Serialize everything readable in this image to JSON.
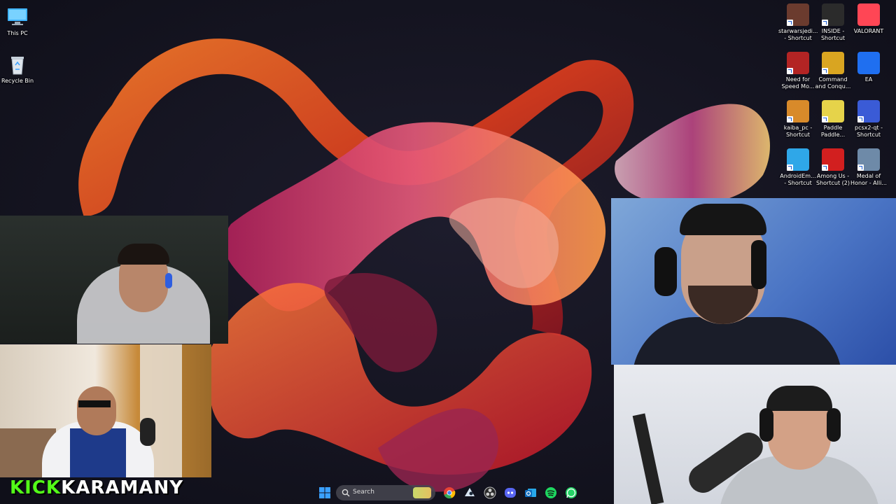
{
  "desktop": {
    "left_icons": [
      {
        "label": "This PC",
        "icon": "monitor-icon"
      },
      {
        "label": "Recycle Bin",
        "icon": "recycle-bin-icon"
      }
    ],
    "right_icons": [
      {
        "line1": "starwarsjedi...",
        "line2": "- Shortcut",
        "icon": "star-wars-jedi-icon",
        "color": "#6b3b2e"
      },
      {
        "line1": "INSIDE -",
        "line2": "Shortcut",
        "icon": "inside-icon",
        "color": "#2b2b2b"
      },
      {
        "line1": "VALORANT",
        "line2": "",
        "icon": "valorant-icon",
        "color": "#ff4655"
      },
      {
        "line1": "Need for",
        "line2": "Speed Mo...",
        "icon": "need-for-speed-icon",
        "color": "#b32424"
      },
      {
        "line1": "Command",
        "line2": "and Conqu...",
        "icon": "command-and-conquer-icon",
        "color": "#d9a521"
      },
      {
        "line1": "EA",
        "line2": "",
        "icon": "ea-icon",
        "color": "#1f6ff0"
      },
      {
        "line1": "kaiba_pc -",
        "line2": "Shortcut",
        "icon": "kaiba-icon",
        "color": "#d88a2a"
      },
      {
        "line1": "Paddle",
        "line2": "Paddle...",
        "icon": "paddle-icon",
        "color": "#e6d34a"
      },
      {
        "line1": "pcsx2-qt -",
        "line2": "Shortcut",
        "icon": "pcsx2-icon",
        "color": "#3a5bd6"
      },
      {
        "line1": "AndroidEm...",
        "line2": "- Shortcut",
        "icon": "android-emulator-icon",
        "color": "#2fa7e8"
      },
      {
        "line1": "Among Us -",
        "line2": "Shortcut (2)",
        "icon": "among-us-icon",
        "color": "#d21f1f"
      },
      {
        "line1": "Medal of",
        "line2": "Honor - Alli...",
        "icon": "medal-of-honor-icon",
        "color": "#6e8aa8"
      }
    ]
  },
  "taskbar": {
    "search_placeholder": "Search",
    "apps": [
      {
        "name": "start-button",
        "icon": "windows-icon",
        "color": "#3aa0ff"
      },
      {
        "name": "widgets-button",
        "icon": "widgets-icon",
        "color": "#c8d86a"
      },
      {
        "name": "chrome-button",
        "icon": "chrome-icon",
        "color": "#e84335"
      },
      {
        "name": "steam-button",
        "icon": "steam-icon",
        "color": "#1b2838"
      },
      {
        "name": "obs-button",
        "icon": "obs-icon",
        "color": "#444444"
      },
      {
        "name": "discord-button",
        "icon": "discord-icon",
        "color": "#5865f2"
      },
      {
        "name": "outlook-button",
        "icon": "outlook-icon",
        "color": "#1f6fd6"
      },
      {
        "name": "spotify-button",
        "icon": "spotify-icon",
        "color": "#1ed760"
      },
      {
        "name": "whatsapp-button",
        "icon": "whatsapp-icon",
        "color": "#25d366"
      }
    ]
  },
  "overlay": {
    "brand_kick": "KICK",
    "brand_name": "KARAMANY",
    "kick_color": "#53fc18",
    "name_color": "#ffffff"
  }
}
